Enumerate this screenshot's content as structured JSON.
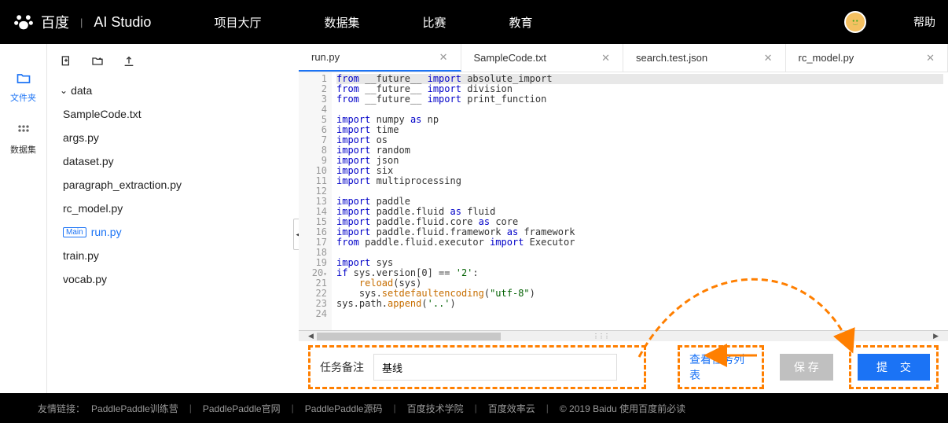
{
  "header": {
    "brand_baidu": "百度",
    "brand_studio": "AI Studio",
    "nav": [
      "项目大厅",
      "数据集",
      "比赛",
      "教育"
    ],
    "help": "帮助"
  },
  "rail": {
    "files": "文件夹",
    "datasets": "数据集"
  },
  "tree": {
    "dir": "data",
    "files": [
      "SampleCode.txt",
      "args.py",
      "dataset.py",
      "paragraph_extraction.py",
      "rc_model.py",
      "run.py",
      "train.py",
      "vocab.py"
    ],
    "main_tag": "Main",
    "selected": "run.py"
  },
  "tabs": [
    {
      "label": "run.py",
      "active": true
    },
    {
      "label": "SampleCode.txt",
      "active": false
    },
    {
      "label": "search.test.json",
      "active": false
    },
    {
      "label": "rc_model.py",
      "active": false
    }
  ],
  "code": {
    "lines": [
      {
        "n": 1,
        "raw": "from __future__ import absolute_import"
      },
      {
        "n": 2,
        "raw": "from __future__ import division"
      },
      {
        "n": 3,
        "raw": "from __future__ import print_function"
      },
      {
        "n": 4,
        "raw": ""
      },
      {
        "n": 5,
        "raw": "import numpy as np"
      },
      {
        "n": 6,
        "raw": "import time"
      },
      {
        "n": 7,
        "raw": "import os"
      },
      {
        "n": 8,
        "raw": "import random"
      },
      {
        "n": 9,
        "raw": "import json"
      },
      {
        "n": 10,
        "raw": "import six"
      },
      {
        "n": 11,
        "raw": "import multiprocessing"
      },
      {
        "n": 12,
        "raw": ""
      },
      {
        "n": 13,
        "raw": "import paddle"
      },
      {
        "n": 14,
        "raw": "import paddle.fluid as fluid"
      },
      {
        "n": 15,
        "raw": "import paddle.fluid.core as core"
      },
      {
        "n": 16,
        "raw": "import paddle.fluid.framework as framework"
      },
      {
        "n": 17,
        "raw": "from paddle.fluid.executor import Executor"
      },
      {
        "n": 18,
        "raw": ""
      },
      {
        "n": 19,
        "raw": "import sys"
      },
      {
        "n": 20,
        "raw": "if sys.version[0] == '2':",
        "fold": true
      },
      {
        "n": 21,
        "raw": "    reload(sys)"
      },
      {
        "n": 22,
        "raw": "    sys.setdefaultencoding(\"utf-8\")"
      },
      {
        "n": 23,
        "raw": "sys.path.append('..')"
      },
      {
        "n": 24,
        "raw": ""
      }
    ]
  },
  "action": {
    "task_label": "任务备注",
    "task_value": "基线",
    "view_tasks": "查看任务列表",
    "save": "保 存",
    "submit": "提 交"
  },
  "footer": {
    "prefix": "友情链接：",
    "links": [
      "PaddlePaddle训练营",
      "PaddlePaddle官网",
      "PaddlePaddle源码",
      "百度技术学院",
      "百度效率云"
    ],
    "copyright": "© 2019 Baidu 使用百度前必读"
  }
}
